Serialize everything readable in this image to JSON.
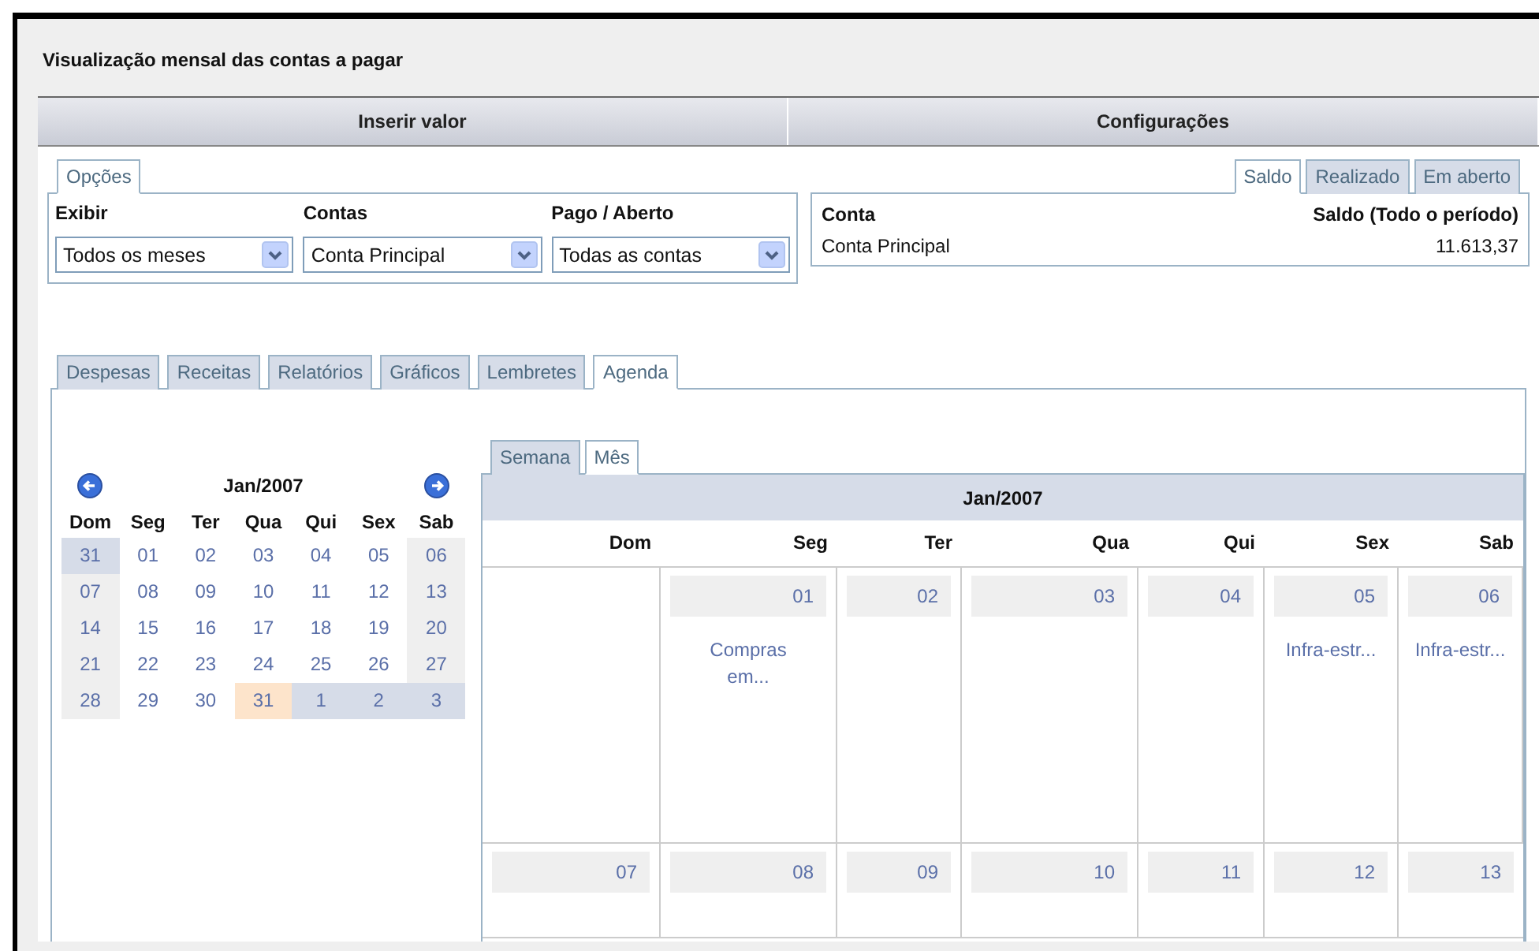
{
  "title": "Visualização mensal das contas a pagar",
  "header": [
    "Inserir valor",
    "Configurações"
  ],
  "options": {
    "tab": "Opções",
    "fields": [
      {
        "label": "Exibir",
        "value": "Todos os meses"
      },
      {
        "label": "Contas",
        "value": "Conta Principal"
      },
      {
        "label": "Pago / Aberto",
        "value": "Todas as contas"
      }
    ]
  },
  "balance_tabs": [
    {
      "label": "Saldo",
      "selected": true
    },
    {
      "label": "Realizado",
      "selected": false
    },
    {
      "label": "Em aberto",
      "selected": false
    }
  ],
  "balance_table": {
    "columns": [
      "Conta",
      "Saldo (Todo o período)"
    ],
    "rows": [
      [
        "Conta Principal",
        "11.613,37"
      ]
    ]
  },
  "main_tabs": [
    {
      "label": "Despesas",
      "selected": false
    },
    {
      "label": "Receitas",
      "selected": false
    },
    {
      "label": "Relatórios",
      "selected": false
    },
    {
      "label": "Gráficos",
      "selected": false
    },
    {
      "label": "Lembretes",
      "selected": false
    },
    {
      "label": "Agenda",
      "selected": true
    }
  ],
  "mini_calendar": {
    "month": "Jan/2007",
    "weekdays": [
      "Dom",
      "Seg",
      "Ter",
      "Qua",
      "Qui",
      "Sex",
      "Sab"
    ],
    "weeks": [
      [
        {
          "day": "31",
          "kind": "other"
        },
        {
          "day": "01",
          "kind": "normal"
        },
        {
          "day": "02",
          "kind": "normal"
        },
        {
          "day": "03",
          "kind": "normal"
        },
        {
          "day": "04",
          "kind": "normal"
        },
        {
          "day": "05",
          "kind": "normal"
        },
        {
          "day": "06",
          "kind": "normal"
        }
      ],
      [
        {
          "day": "07",
          "kind": "normal"
        },
        {
          "day": "08",
          "kind": "normal"
        },
        {
          "day": "09",
          "kind": "normal"
        },
        {
          "day": "10",
          "kind": "normal"
        },
        {
          "day": "11",
          "kind": "normal"
        },
        {
          "day": "12",
          "kind": "normal"
        },
        {
          "day": "13",
          "kind": "normal"
        }
      ],
      [
        {
          "day": "14",
          "kind": "normal"
        },
        {
          "day": "15",
          "kind": "normal"
        },
        {
          "day": "16",
          "kind": "normal"
        },
        {
          "day": "17",
          "kind": "normal"
        },
        {
          "day": "18",
          "kind": "normal"
        },
        {
          "day": "19",
          "kind": "normal"
        },
        {
          "day": "20",
          "kind": "normal"
        }
      ],
      [
        {
          "day": "21",
          "kind": "normal"
        },
        {
          "day": "22",
          "kind": "normal"
        },
        {
          "day": "23",
          "kind": "normal"
        },
        {
          "day": "24",
          "kind": "normal"
        },
        {
          "day": "25",
          "kind": "normal"
        },
        {
          "day": "26",
          "kind": "normal"
        },
        {
          "day": "27",
          "kind": "normal"
        }
      ],
      [
        {
          "day": "28",
          "kind": "normal"
        },
        {
          "day": "29",
          "kind": "normal"
        },
        {
          "day": "30",
          "kind": "normal"
        },
        {
          "day": "31",
          "kind": "today"
        },
        {
          "day": "1",
          "kind": "other"
        },
        {
          "day": "2",
          "kind": "other"
        },
        {
          "day": "3",
          "kind": "other"
        }
      ]
    ]
  },
  "view_tabs": [
    {
      "label": "Semana",
      "selected": false
    },
    {
      "label": "Mês",
      "selected": true
    }
  ],
  "month_view": {
    "month": "Jan/2007",
    "weekdays": [
      "Dom",
      "Seg",
      "Ter",
      "Qua",
      "Qui",
      "Sex",
      "Sab"
    ],
    "weeks": [
      [
        {
          "kind": "blank"
        },
        {
          "kind": "day",
          "day": "01",
          "events": [
            "Compras em..."
          ]
        },
        {
          "kind": "day",
          "day": "02"
        },
        {
          "kind": "day",
          "day": "03"
        },
        {
          "kind": "day",
          "day": "04"
        },
        {
          "kind": "day",
          "day": "05",
          "events": [
            "Infra-estr..."
          ]
        },
        {
          "kind": "day",
          "day": "06",
          "events": [
            "Infra-estr..."
          ]
        }
      ],
      [
        {
          "kind": "day",
          "day": "07"
        },
        {
          "kind": "day",
          "day": "08"
        },
        {
          "kind": "day",
          "day": "09"
        },
        {
          "kind": "day",
          "day": "10"
        },
        {
          "kind": "day",
          "day": "11"
        },
        {
          "kind": "day",
          "day": "12"
        },
        {
          "kind": "day",
          "day": "13"
        }
      ]
    ]
  }
}
